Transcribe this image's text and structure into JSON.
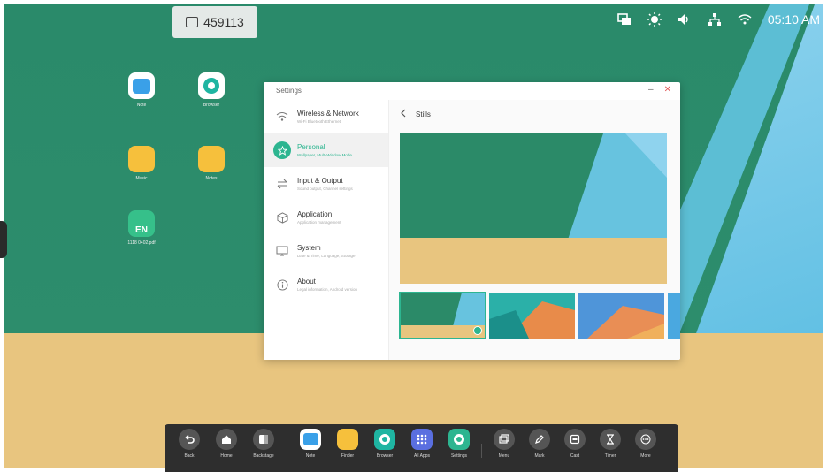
{
  "top_bar": {
    "room_code": "459113",
    "time": "05:10 AM",
    "icons": [
      "screen-mirror-icon",
      "brightness-icon",
      "volume-icon",
      "network-icon",
      "wifi-icon"
    ]
  },
  "desktop": {
    "icons": [
      {
        "label": "Note",
        "icon": "note-icon"
      },
      {
        "label": "Browser",
        "icon": "browser-icon"
      },
      {
        "label": "Music",
        "icon": "folder-icon"
      },
      {
        "label": "Notes",
        "icon": "folder-icon"
      },
      {
        "label": "1118 0402.pdf",
        "icon": "file-icon",
        "badge": "EN"
      }
    ]
  },
  "settings": {
    "title": "Settings",
    "nav": [
      {
        "title": "Wireless & Network",
        "sub": "Wi-Fi Bluetooth Ethernet",
        "icon": "wifi-icon",
        "active": false
      },
      {
        "title": "Personal",
        "sub": "Wallpaper, Multi-Window Mode",
        "icon": "star-icon",
        "active": true
      },
      {
        "title": "Input & Output",
        "sub": "Sound output, Channel settings",
        "icon": "swap-icon",
        "active": false
      },
      {
        "title": "Application",
        "sub": "Application management",
        "icon": "cube-icon",
        "active": false
      },
      {
        "title": "System",
        "sub": "Date & Time, Language, Storage",
        "icon": "monitor-icon",
        "active": false
      },
      {
        "title": "About",
        "sub": "Legal information, Android version",
        "icon": "info-icon",
        "active": false
      }
    ],
    "content_title": "Stills"
  },
  "dock": {
    "items": [
      {
        "label": "Back",
        "icon": "back-icon"
      },
      {
        "label": "Home",
        "icon": "home-icon"
      },
      {
        "label": "Backstage",
        "icon": "backstage-icon"
      },
      {
        "label": "Note",
        "icon": "note-icon"
      },
      {
        "label": "Finder",
        "icon": "finder-icon"
      },
      {
        "label": "Browser",
        "icon": "browser-icon"
      },
      {
        "label": "All Apps",
        "icon": "apps-grid-icon"
      },
      {
        "label": "Settings",
        "icon": "settings-icon"
      },
      {
        "label": "Menu",
        "icon": "menu-icon"
      },
      {
        "label": "Mark",
        "icon": "pen-icon"
      },
      {
        "label": "Cast",
        "icon": "cast-icon"
      },
      {
        "label": "Timer",
        "icon": "hourglass-icon"
      },
      {
        "label": "More",
        "icon": "more-icon"
      }
    ]
  },
  "colors": {
    "accent": "#2db590",
    "wallpaper_green": "#2b8a68",
    "wallpaper_sand": "#e8c57f",
    "wallpaper_blue": "#65c7e6"
  }
}
